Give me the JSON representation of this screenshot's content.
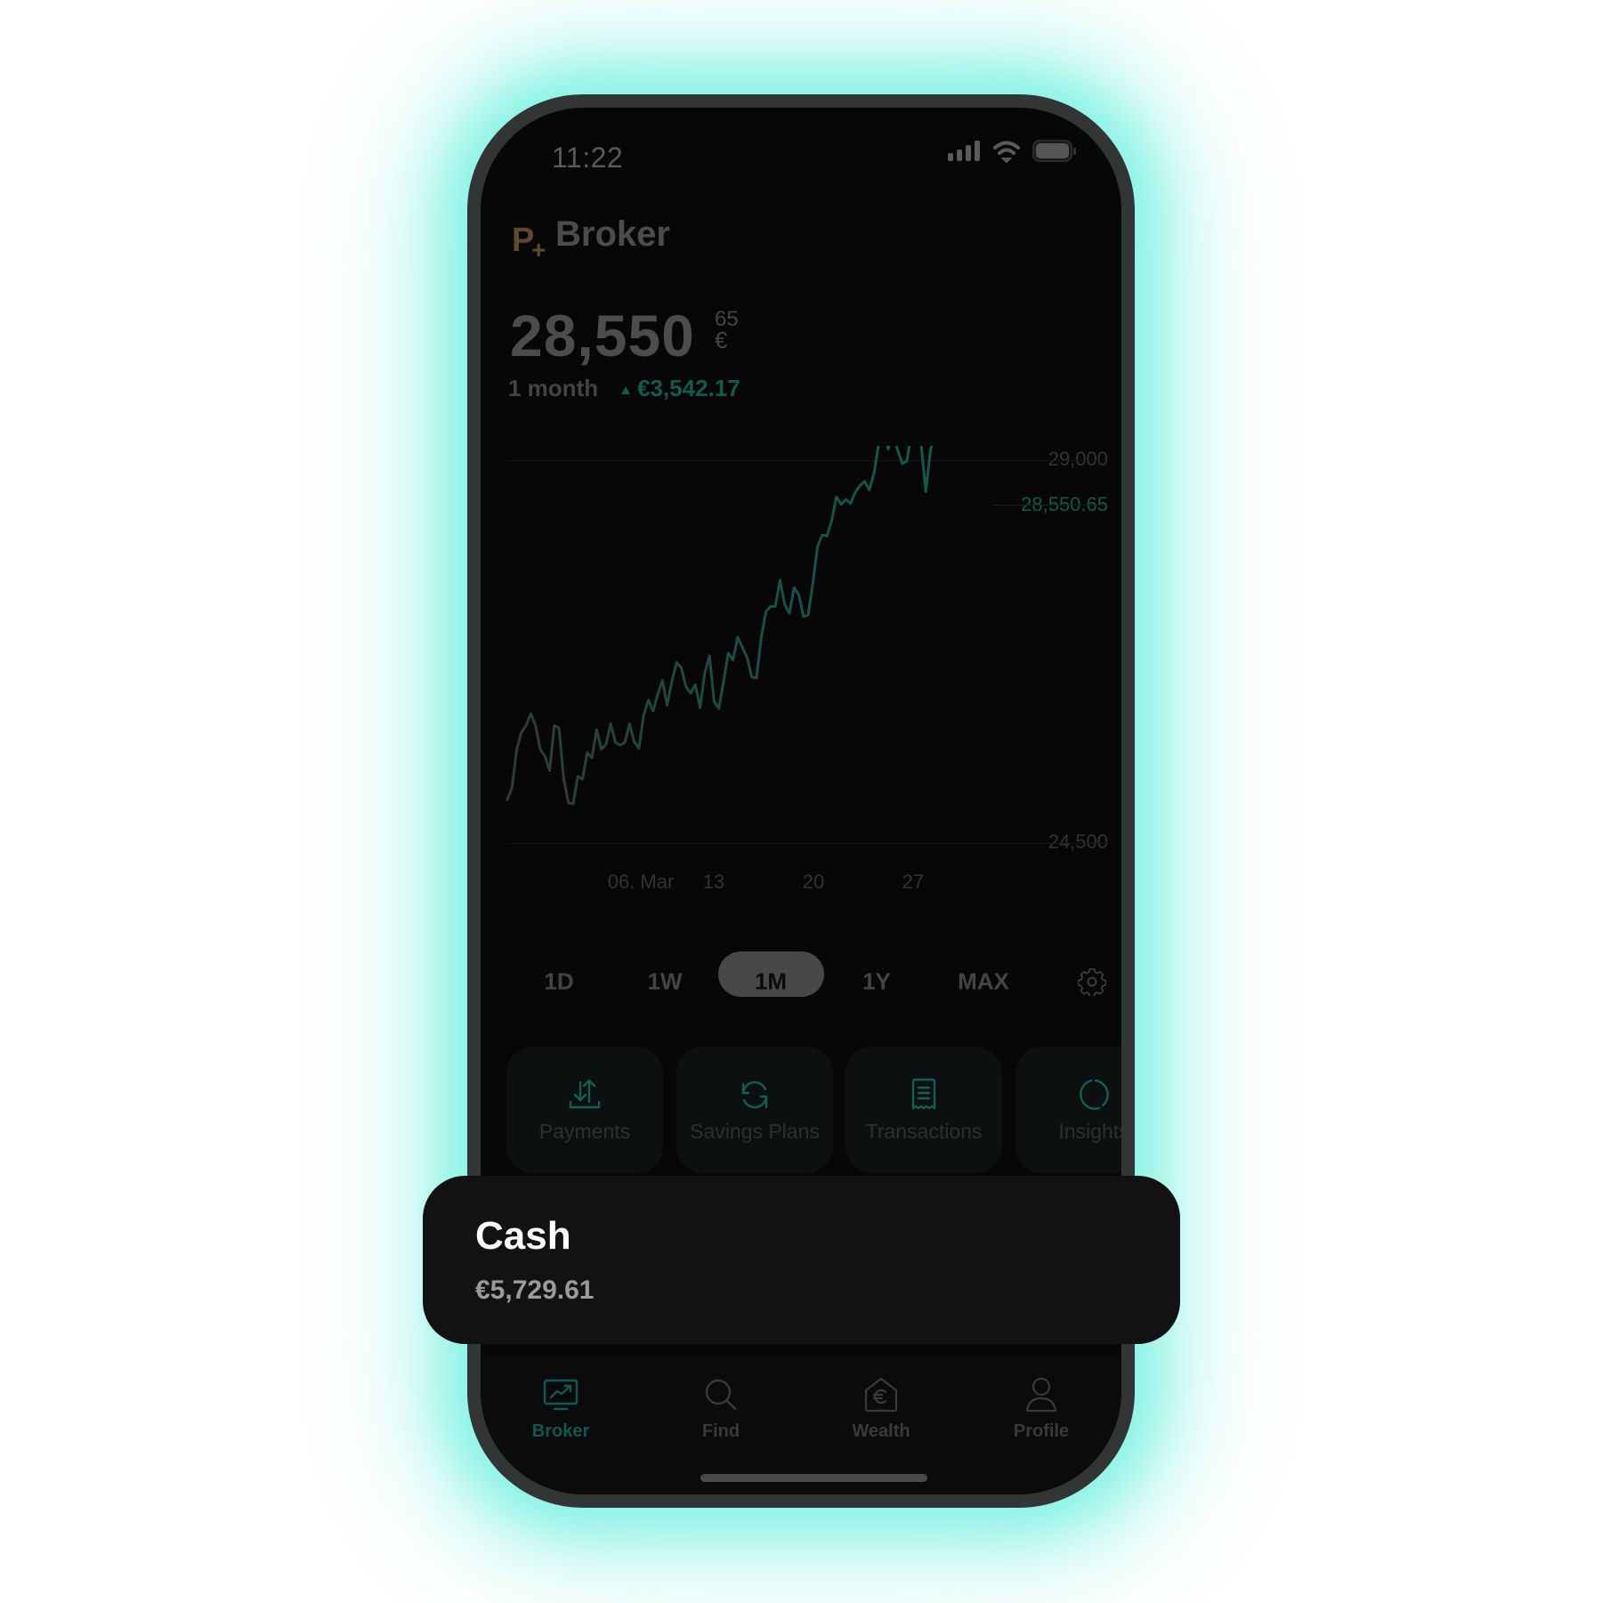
{
  "status_bar": {
    "time": "11:22",
    "icons": [
      "signal-icon",
      "wifi-icon",
      "battery-icon"
    ]
  },
  "header": {
    "logo": "P",
    "logo_plus": "+",
    "title": "Broker"
  },
  "portfolio": {
    "value_main": "28,550",
    "value_cents": "65",
    "currency": "€",
    "period_label": "1 month",
    "change": "€3,542.17",
    "change_direction": "up"
  },
  "colors": {
    "accent": "#145a4c",
    "logo": "#5d4a2e",
    "glow": "#8ef2e0",
    "card_bg": "#0b1010"
  },
  "chart_data": {
    "type": "line",
    "title": "",
    "xlabel": "",
    "ylabel": "",
    "ylim": [
      24500,
      29000
    ],
    "y_ticks": [
      "29,000",
      "24,500"
    ],
    "y_tick_values": [
      29000,
      24500
    ],
    "current_value_label": "28,550.65",
    "current_value": 28550.65,
    "x_ticks": [
      "06. Mar",
      "13",
      "20",
      "27"
    ],
    "x_tick_positions": [
      0.235,
      0.36,
      0.53,
      0.698
    ],
    "grid": true,
    "series": [
      {
        "name": "Portfolio value",
        "values": [
          25010,
          25150,
          25600,
          25800,
          25880,
          26020,
          25880,
          25600,
          25520,
          25350,
          25880,
          25850,
          25250,
          24970,
          24960,
          25280,
          25250,
          25560,
          25500,
          25830,
          25600,
          25660,
          25900,
          25680,
          25650,
          25680,
          25900,
          25690,
          25610,
          26000,
          26180,
          26050,
          26250,
          26410,
          26120,
          26400,
          26620,
          26560,
          26340,
          26260,
          26360,
          26090,
          26500,
          26700,
          26160,
          26080,
          26400,
          26730,
          26650,
          26920,
          26800,
          26680,
          26450,
          26440,
          26910,
          27220,
          27280,
          27280,
          27590,
          27300,
          27200,
          27500,
          27420,
          27160,
          27180,
          27560,
          27990,
          28120,
          28110,
          28290,
          28570,
          28480,
          28540,
          28490,
          28620,
          28700,
          28750,
          28650,
          28850,
          29190,
          29350,
          29130,
          29310,
          29120,
          28960,
          28990,
          29350,
          29380,
          29200,
          28630,
          29120,
          29300,
          29420,
          29330,
          29300,
          29340,
          29340,
          29450,
          29470,
          29490
        ]
      }
    ],
    "legend": "none"
  },
  "range_tabs": [
    {
      "label": "1D",
      "active": false
    },
    {
      "label": "1W",
      "active": false
    },
    {
      "label": "1M",
      "active": true
    },
    {
      "label": "1Y",
      "active": false
    },
    {
      "label": "MAX",
      "active": false
    }
  ],
  "range_settings_icon": "gear-icon",
  "quick_actions": [
    {
      "label": "Payments",
      "icon": "transfer-arrows-icon"
    },
    {
      "label": "Savings Plans",
      "icon": "refresh-cycle-icon"
    },
    {
      "label": "Transactions",
      "icon": "receipt-icon"
    },
    {
      "label": "Insights",
      "icon": "donut-chart-icon"
    }
  ],
  "cash_card": {
    "title": "Cash",
    "amount": "€5,729.61"
  },
  "bottom_nav": [
    {
      "label": "Broker",
      "icon": "chart-monitor-icon",
      "active": true
    },
    {
      "label": "Find",
      "icon": "search-icon",
      "active": false
    },
    {
      "label": "Wealth",
      "icon": "euro-house-icon",
      "active": false
    },
    {
      "label": "Profile",
      "icon": "person-icon",
      "active": false
    }
  ]
}
